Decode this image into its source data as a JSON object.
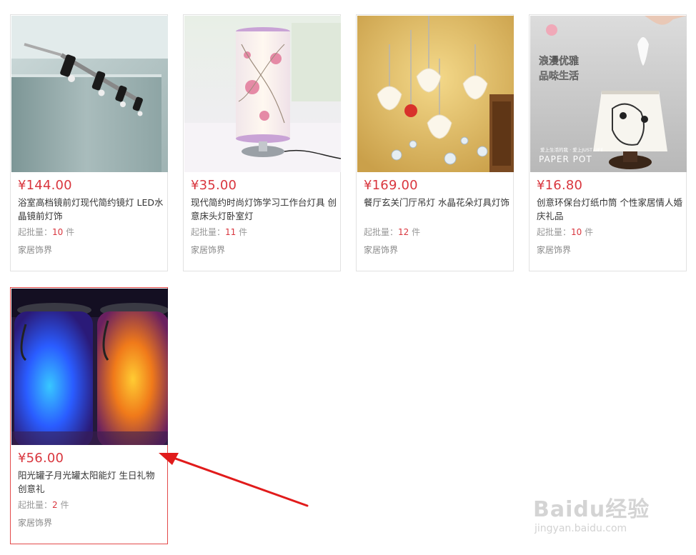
{
  "products": [
    {
      "price": "¥144.00",
      "title": "浴室高档镜前灯现代简约镜灯 LED水晶镜前灯饰",
      "moq_label": "起批量：",
      "moq_num": "10",
      "moq_unit": " 件",
      "shop": "家居饰界"
    },
    {
      "price": "¥35.00",
      "title": "现代简约时尚灯饰学习工作台灯具 创意床头灯卧室灯",
      "moq_label": "起批量：",
      "moq_num": "11",
      "moq_unit": " 件",
      "shop": "家居饰界"
    },
    {
      "price": "¥169.00",
      "title": "餐厅玄关门厅吊灯 水晶花朵灯具灯饰",
      "moq_label": "起批量：",
      "moq_num": "12",
      "moq_unit": " 件",
      "shop": "家居饰界"
    },
    {
      "price": "¥16.80",
      "title": "创意环保台灯纸巾筒 个性家居情人婚庆礼品",
      "moq_label": "起批量：",
      "moq_num": "10",
      "moq_unit": " 件",
      "shop": "家居饰界"
    },
    {
      "price": "¥56.00",
      "title": "阳光罐子月光罐太阳能灯 生日礼物 创意礼",
      "moq_label": "起批量：",
      "moq_num": "2",
      "moq_unit": " 件",
      "shop": "家居饰界"
    }
  ],
  "image_text": {
    "paper_pot_cn_line1": "浪漫优雅",
    "paper_pot_cn_line2": "品味生活",
    "paper_pot_small": "爱上生活的我 · 爱上JUST LIFE",
    "paper_pot_en": "PAPER POT"
  },
  "watermark": {
    "brand": "Baidu经验",
    "url": "jingyan.baidu.com"
  },
  "colors": {
    "price": "#d9363e",
    "active_border": "#e34a4a",
    "arrow": "#e11b1b"
  }
}
